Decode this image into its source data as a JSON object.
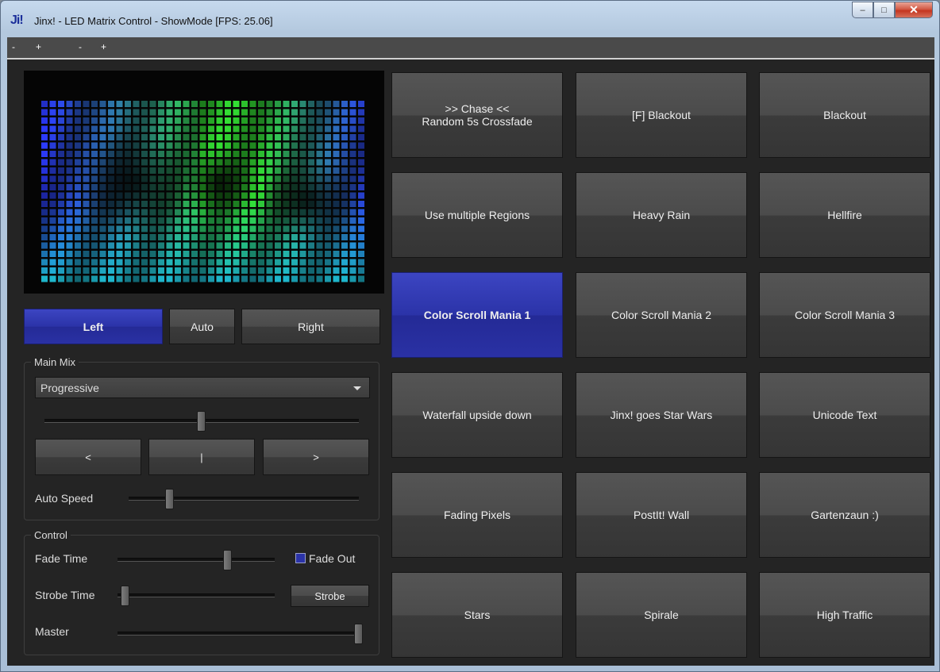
{
  "window": {
    "logo": "Ji!",
    "title": "Jinx! - LED Matrix Control - ShowMode [FPS: 25.06]",
    "controls": {
      "minimize": "–",
      "maximize": "□",
      "close": "✕"
    }
  },
  "menubar": [
    "-",
    "+",
    "-",
    "+"
  ],
  "preview": {
    "cols": 39,
    "rows": 22,
    "colors": {
      "blue": "#2c3bff",
      "green": "#33e033",
      "cyan": "#1fbad0"
    }
  },
  "direction": {
    "left": "Left",
    "auto": "Auto",
    "right": "Right",
    "active": "left"
  },
  "main_mix": {
    "label": "Main Mix",
    "mode": "Progressive",
    "crossfader": 0.5,
    "buttons": {
      "prev": "<",
      "stop": "|",
      "next": ">"
    },
    "auto_speed_label": "Auto Speed",
    "auto_speed": 0.18
  },
  "control": {
    "label": "Control",
    "fade_time_label": "Fade Time",
    "fade_time": 0.7,
    "fade_out_label": "Fade Out",
    "fade_out": true,
    "strobe_time_label": "Strobe Time",
    "strobe_time": 0.05,
    "strobe_button": "Strobe",
    "master_label": "Master",
    "master": 1.0
  },
  "accent": "#2b33a8",
  "effects": [
    {
      "line1": ">> Chase <<",
      "line2": "Random 5s Crossfade"
    },
    {
      "line1": "[F] Blackout"
    },
    {
      "line1": "Blackout"
    },
    {
      "line1": "Use multiple Regions"
    },
    {
      "line1": "Heavy Rain"
    },
    {
      "line1": "Hellfire"
    },
    {
      "line1": "Color Scroll Mania 1",
      "active": true
    },
    {
      "line1": "Color Scroll Mania 2"
    },
    {
      "line1": "Color Scroll Mania 3"
    },
    {
      "line1": "Waterfall upside down"
    },
    {
      "line1": "Jinx! goes Star Wars"
    },
    {
      "line1": "Unicode Text"
    },
    {
      "line1": "Fading Pixels"
    },
    {
      "line1": "PostIt! Wall"
    },
    {
      "line1": "Gartenzaun :)"
    },
    {
      "line1": "Stars"
    },
    {
      "line1": "Spirale"
    },
    {
      "line1": "High Traffic"
    }
  ]
}
